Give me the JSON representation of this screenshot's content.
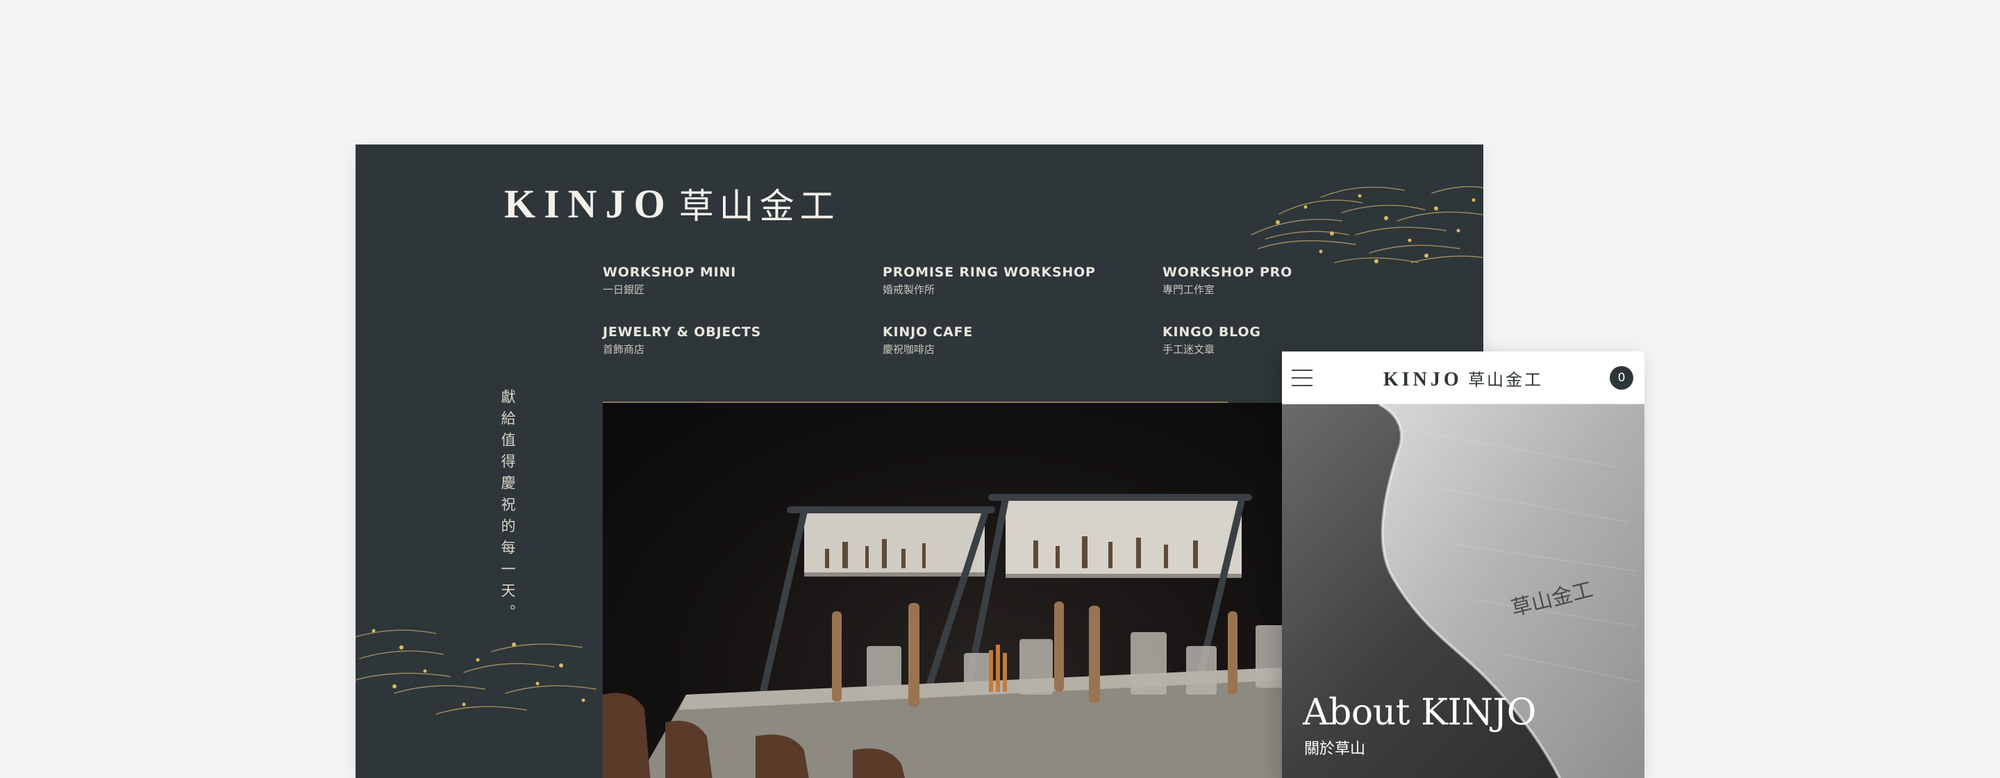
{
  "desktop": {
    "brand": {
      "en": "KINJO",
      "zh": "草山金工"
    },
    "nav": [
      {
        "en": "WORKSHOP MINI",
        "zh": "一日銀匠"
      },
      {
        "en": "PROMISE RING WORKSHOP",
        "zh": "婚戒製作所"
      },
      {
        "en": "WORKSHOP PRO",
        "zh": "專門工作室"
      },
      {
        "en": "JEWELRY & OBJECTS",
        "zh": "首飾商店"
      },
      {
        "en": "KINJO CAFE",
        "zh": "慶祝咖啡店"
      },
      {
        "en": "KINGO BLOG",
        "zh": "手工迷文章"
      }
    ],
    "tagline": "獻給值得慶祝的每一天。",
    "hero_image": "workshop-benches-photo"
  },
  "mobile": {
    "brand": {
      "en": "KINJO",
      "zh": "草山金工"
    },
    "cart_count": "0",
    "hero": {
      "title": "About KINJO",
      "subtitle": "關於草山",
      "image": "engraved-silver-plate-photo"
    }
  },
  "colors": {
    "page_background": "#f4f4f4",
    "desktop_background": "#2e363a",
    "accent_gold": "#b89a5a",
    "text_light": "#e9e6df"
  }
}
